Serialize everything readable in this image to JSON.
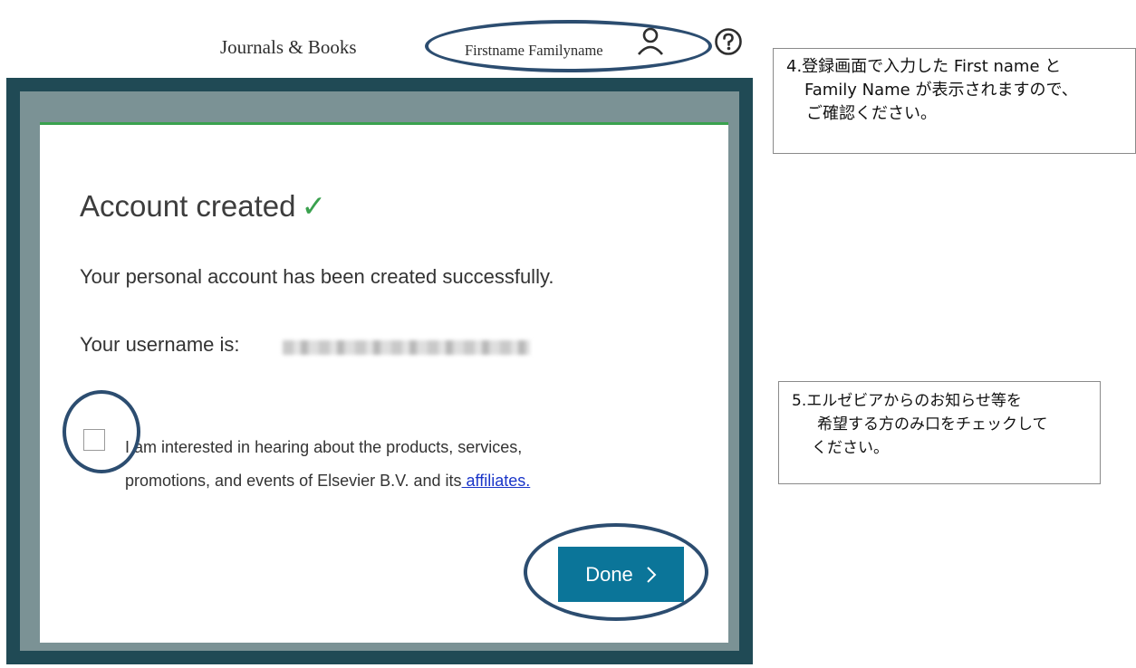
{
  "header": {
    "journals_books": "Journals & Books",
    "user_name": "Firstname Familyname"
  },
  "dialog": {
    "title": "Account created",
    "message": "Your personal account has been created successfully.",
    "username_label": "Your username is:",
    "consent_text_line1": "I am interested in hearing about the products, services,",
    "consent_text_line2": "promotions, and events of Elsevier B.V. and its",
    "consent_link": " affiliates.",
    "done_label": "Done",
    "consent_checked": false
  },
  "notes": {
    "note4": {
      "line1": "4.登録画面で入力した First name と",
      "line2": "Family Name が表示されますので、",
      "line3": "ご確認ください。"
    },
    "note5": {
      "line1": "5.エルゼビアからのお知らせ等を",
      "line2": "希望する方のみ口をチェックして",
      "line3": "ください。"
    }
  },
  "colors": {
    "accent_green": "#3aa14e",
    "button_blue": "#0b7599",
    "annotation_ring": "#2c4d70",
    "frame_dark": "#204a55",
    "frame_gray": "#7b9295",
    "link_blue": "#1a35c8"
  },
  "icons": {
    "user": "user-icon",
    "help": "help-icon",
    "check": "checkmark-icon",
    "chevron": "chevron-right-icon"
  }
}
